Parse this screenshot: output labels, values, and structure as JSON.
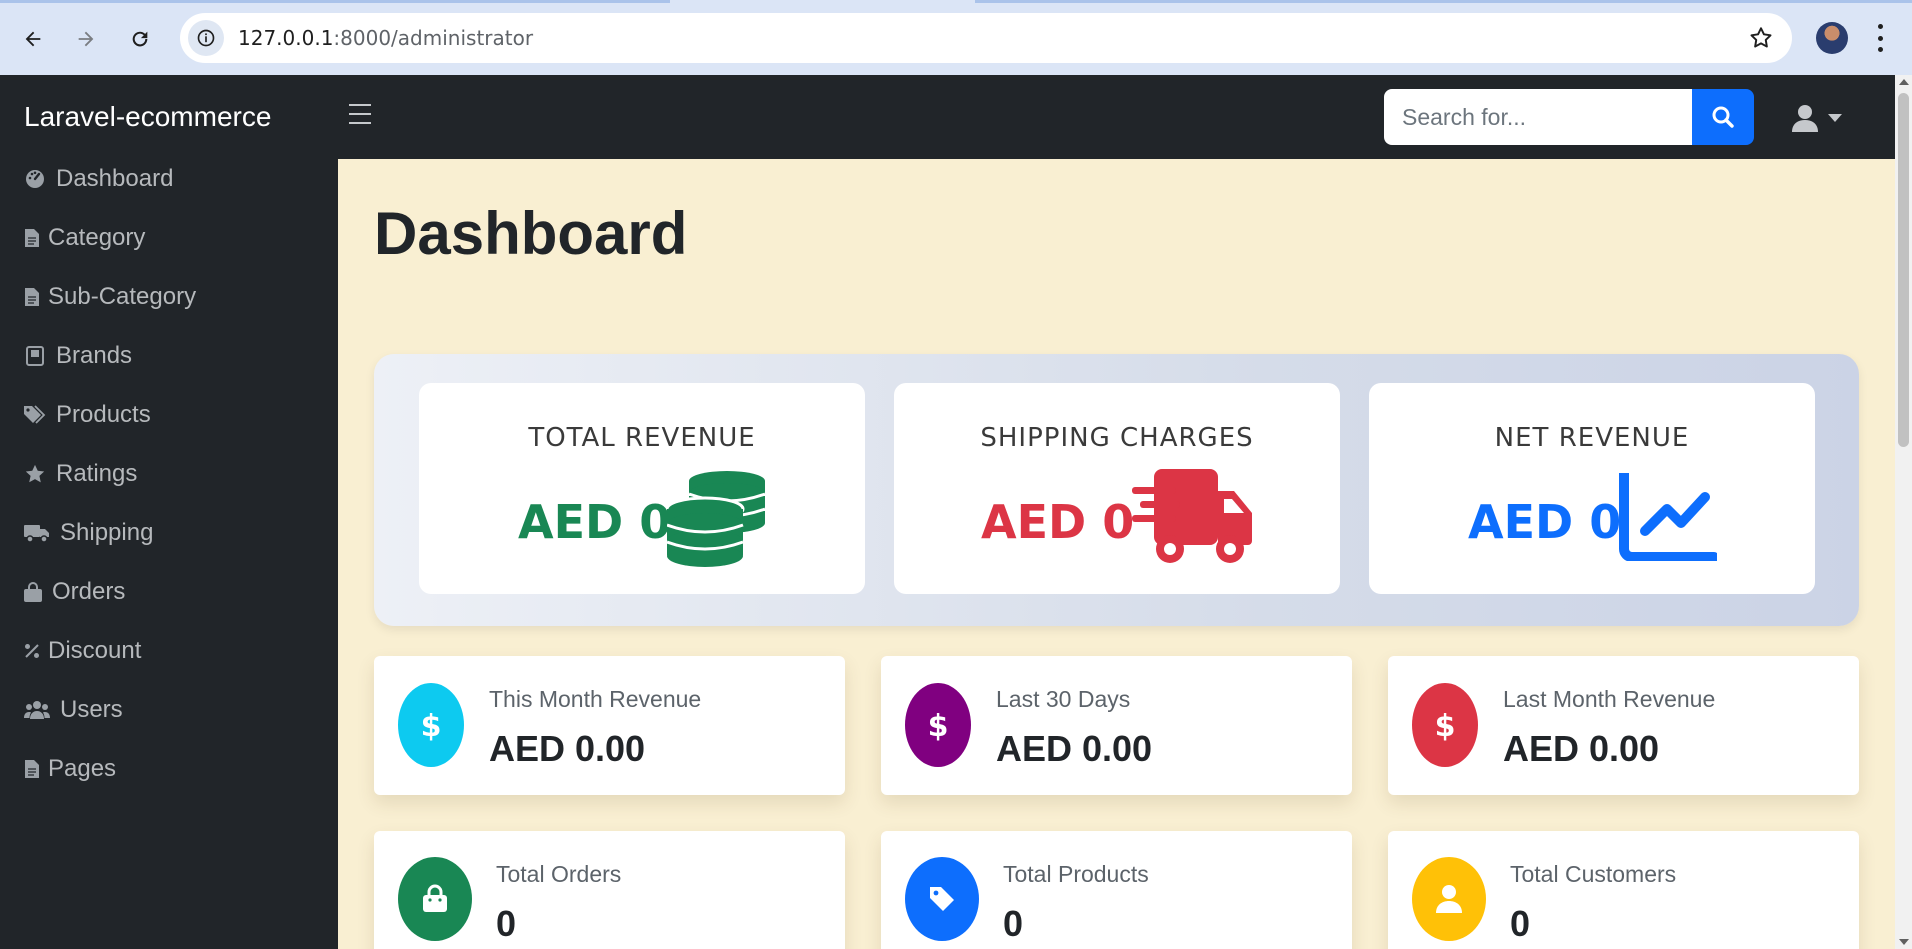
{
  "browser": {
    "url_host": "127.0.0.1",
    "url_rest": ":8000/administrator",
    "icons": [
      "back-icon",
      "forward-icon",
      "reload-icon",
      "site-info-icon",
      "bookmark-star-icon",
      "profile-avatar",
      "kebab-menu-icon"
    ]
  },
  "app": {
    "brand": "Laravel-ecommerce",
    "search": {
      "placeholder": "Search for..."
    }
  },
  "sidebar": {
    "items": [
      {
        "label": "Dashboard",
        "icon": "gauge-icon"
      },
      {
        "label": "Category",
        "icon": "file-icon"
      },
      {
        "label": "Sub-Category",
        "icon": "file-icon"
      },
      {
        "label": "Brands",
        "icon": "book-icon"
      },
      {
        "label": "Products",
        "icon": "tags-icon"
      },
      {
        "label": "Ratings",
        "icon": "star-icon"
      },
      {
        "label": "Shipping",
        "icon": "truck-icon"
      },
      {
        "label": "Orders",
        "icon": "bag-icon"
      },
      {
        "label": "Discount",
        "icon": "percent-icon"
      },
      {
        "label": "Users",
        "icon": "users-icon"
      },
      {
        "label": "Pages",
        "icon": "file-icon"
      }
    ]
  },
  "main": {
    "title": "Dashboard",
    "summary": [
      {
        "title": "TOTAL REVENUE",
        "value": "AED 0",
        "color": "#198754",
        "icon": "coins-icon"
      },
      {
        "title": "SHIPPING CHARGES",
        "value": "AED 0",
        "color": "#dc3545",
        "icon": "shipping-truck-icon"
      },
      {
        "title": "NET REVENUE",
        "value": "AED 0",
        "color": "#0d6efd",
        "icon": "line-chart-icon"
      }
    ],
    "stats": [
      {
        "label": "This Month Revenue",
        "value": "AED 0.00",
        "color": "#0dcaf0",
        "icon": "dollar-icon"
      },
      {
        "label": "Last 30 Days",
        "value": "AED 0.00",
        "color": "#800080",
        "icon": "dollar-icon"
      },
      {
        "label": "Last Month Revenue",
        "value": "AED 0.00",
        "color": "#dc3545",
        "icon": "dollar-icon"
      },
      {
        "label": "Total Orders",
        "value": "0",
        "color": "#198754",
        "icon": "shopping-bag-icon"
      },
      {
        "label": "Total Products",
        "value": "0",
        "color": "#0d6efd",
        "icon": "tag-icon"
      },
      {
        "label": "Total Customers",
        "value": "0",
        "color": "#ffc107",
        "icon": "user-icon"
      }
    ]
  }
}
